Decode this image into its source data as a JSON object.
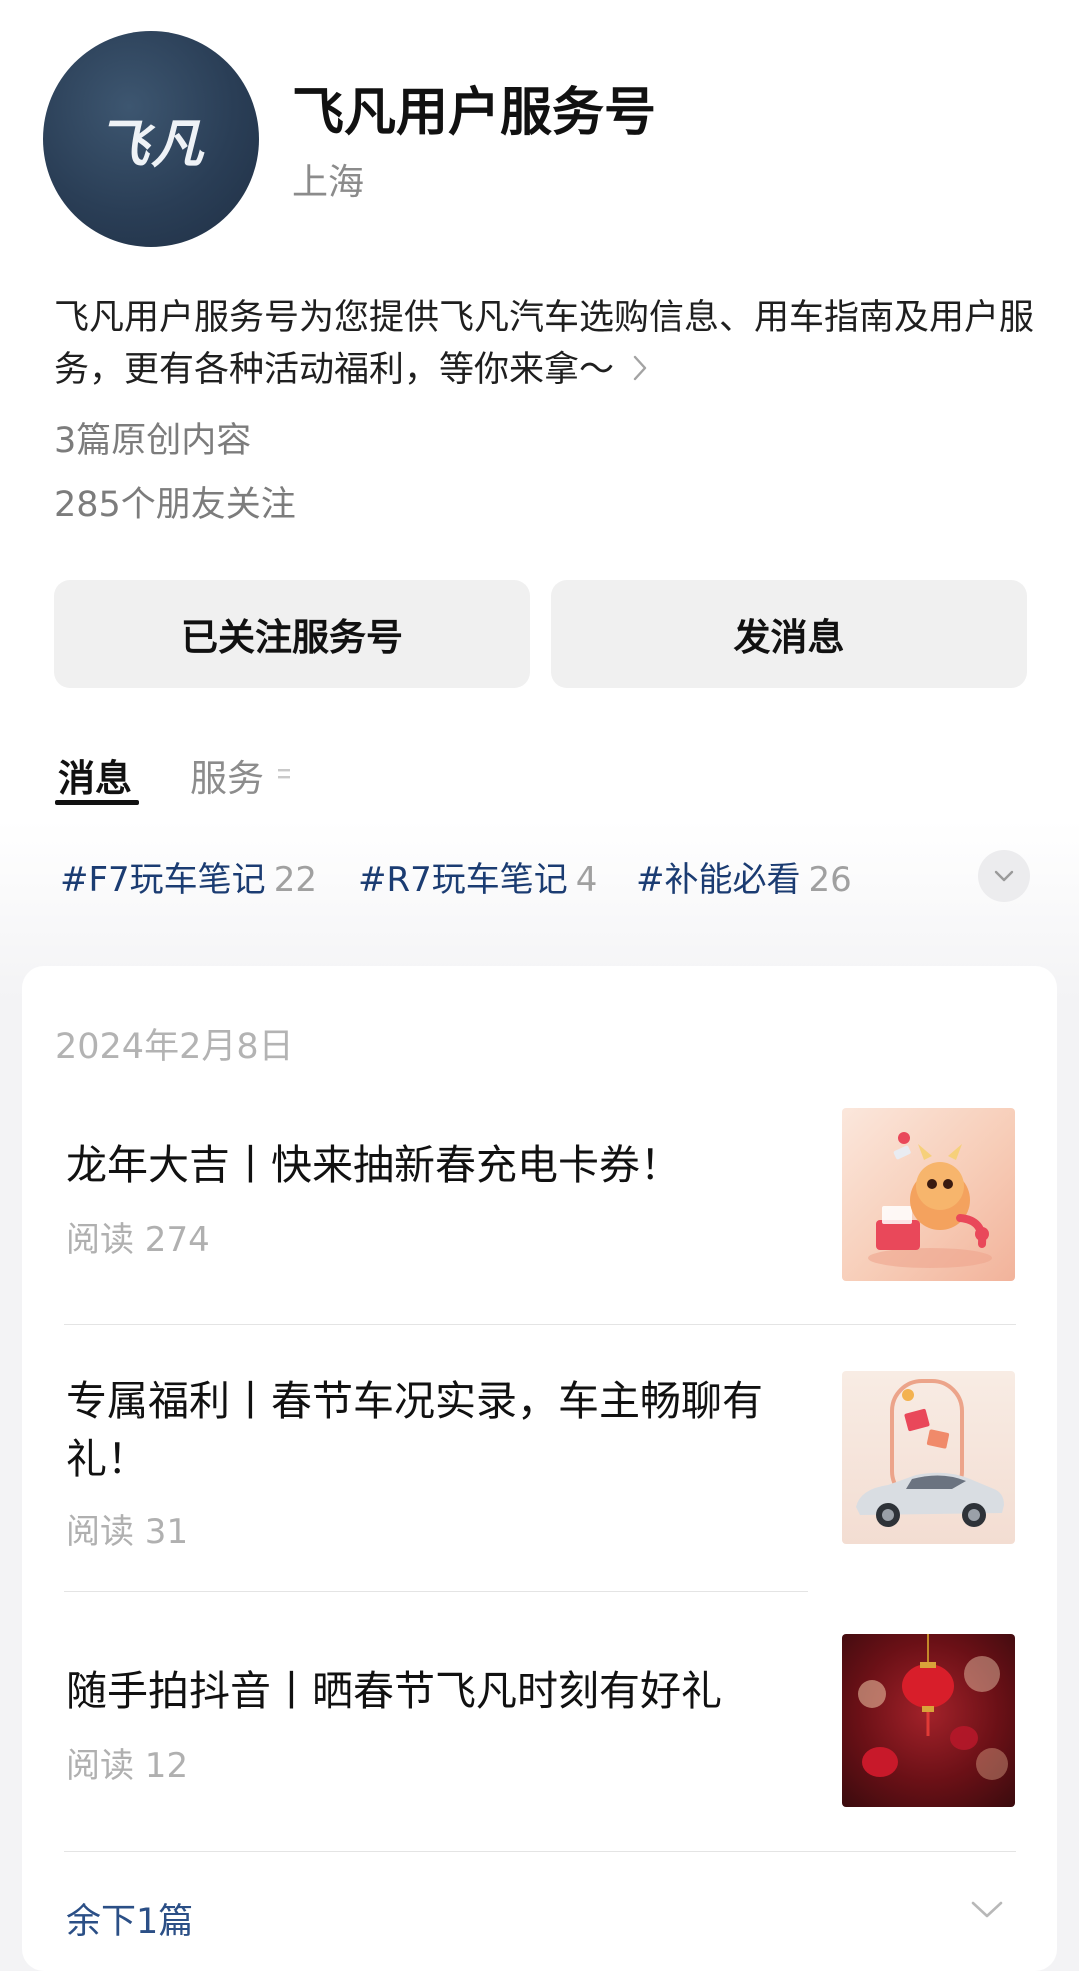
{
  "account": {
    "logo_text": "飞凡",
    "name": "飞凡用户服务号",
    "location": "上海",
    "description": "飞凡用户服务号为您提供飞凡汽车选购信息、用车指南及用户服务，更有各种活动福利，等你来拿～",
    "original_count": "3篇原创内容",
    "friends_following": "285个朋友关注"
  },
  "actions": {
    "follow_label": "已关注服务号",
    "message_label": "发消息"
  },
  "tabs": [
    {
      "label": "消息",
      "active": true
    },
    {
      "label": "服务",
      "active": false
    }
  ],
  "tags": [
    {
      "label": "#F7玩车笔记",
      "count": "22"
    },
    {
      "label": "#R7玩车笔记",
      "count": "4"
    },
    {
      "label": "#补能必看",
      "count": "26"
    }
  ],
  "feed": {
    "date": "2024年2月8日",
    "articles": [
      {
        "title": "龙年大吉丨快来抽新春充电卡券！",
        "reads": "阅读 274",
        "thumb_icon": "dragon-new-year-illustration"
      },
      {
        "title": "专属福利丨春节车况实录，车主畅聊有礼！",
        "reads": "阅读 31",
        "thumb_icon": "car-with-red-envelopes"
      },
      {
        "title": "随手拍抖音丨晒春节飞凡时刻有好礼",
        "reads": "阅读 12",
        "thumb_icon": "red-lanterns-photo"
      }
    ],
    "remaining_label": "余下1篇"
  },
  "colors": {
    "link_blue": "#1b3c72",
    "avatar_navy": "#2a3e56",
    "button_bg": "#f0f0f0",
    "muted_text": "#8b8b8b"
  }
}
